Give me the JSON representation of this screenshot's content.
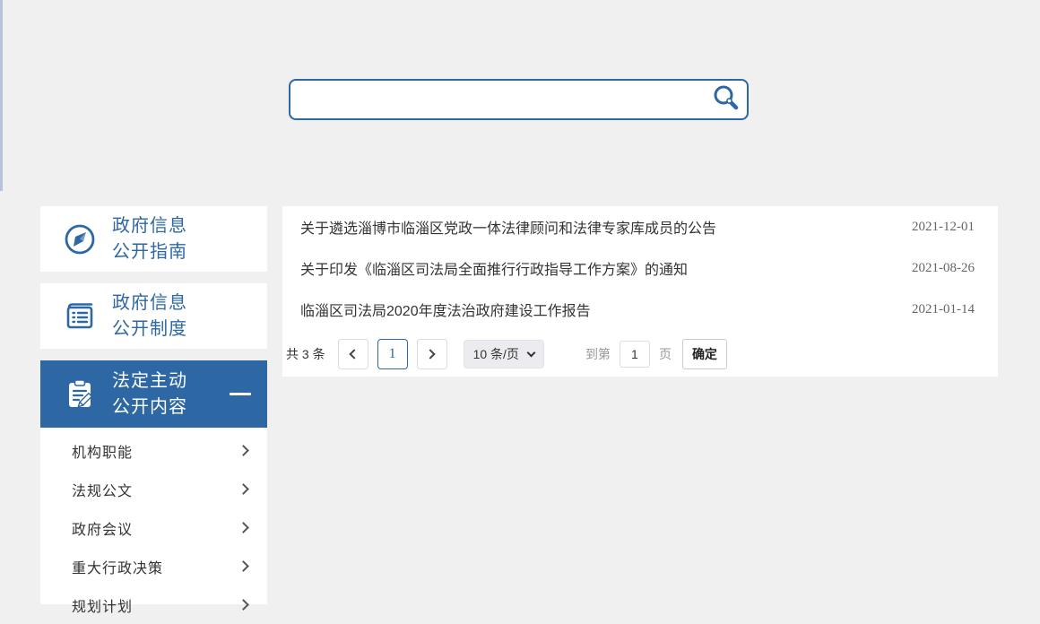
{
  "page": {
    "background": "#f0f0f0",
    "accent": "#2e68a4"
  },
  "search": {
    "value": "",
    "placeholder": "",
    "icon": "magnifier-icon"
  },
  "sidebar": {
    "cards": [
      {
        "icon": "compass-icon",
        "line1": "政府信息",
        "line2": "公开指南",
        "active": false
      },
      {
        "icon": "rules-document-icon",
        "line1": "政府信息",
        "line2": "公开制度",
        "active": false
      },
      {
        "icon": "clipboard-pencil-icon",
        "line1": "法定主动",
        "line2": "公开内容",
        "active": true,
        "collapse_icon": "minus-icon"
      }
    ],
    "submenu": [
      {
        "label": "机构职能",
        "icon": "chevron-right-icon"
      },
      {
        "label": "法规公文",
        "icon": "chevron-right-icon"
      },
      {
        "label": "政府会议",
        "icon": "chevron-right-icon"
      },
      {
        "label": "重大行政决策",
        "icon": "chevron-right-icon"
      },
      {
        "label": "规划计划",
        "icon": "chevron-right-icon"
      }
    ]
  },
  "list": {
    "items": [
      {
        "title": "关于遴选淄博市临淄区党政一体法律顾问和法律专家库成员的公告",
        "date": "2021-12-01"
      },
      {
        "title": "关于印发《临淄区司法局全面推行行政指导工作方案》的通知",
        "date": "2021-08-26"
      },
      {
        "title": "临淄区司法局2020年度法治政府建设工作报告",
        "date": "2021-01-14"
      }
    ]
  },
  "pagination": {
    "total_label": "共 3 条",
    "current_page": "1",
    "page_size_label": "10 条/页",
    "goto_prefix": "到第",
    "goto_value": "1",
    "goto_suffix": "页",
    "confirm_label": "确定"
  }
}
